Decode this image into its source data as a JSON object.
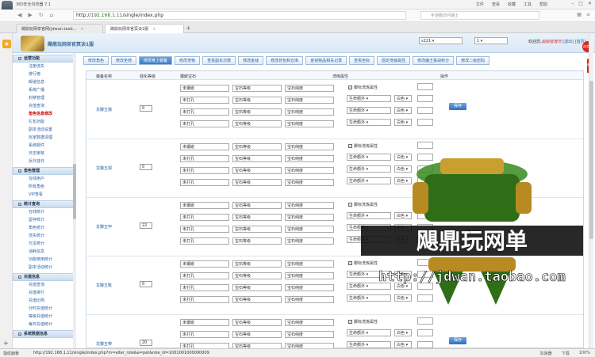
{
  "browser": {
    "title": "360安全浏览器 7.1",
    "menu": [
      "文件",
      "查看",
      "收藏",
      "工具",
      "帮助"
    ],
    "url_prefix": "http://",
    "url_host": "192.168.1.11",
    "url_path": "/single/index.php",
    "search_placeholder": "手游圈访问瑞士",
    "tabs": [
      {
        "label": "飓鼎玩网单官网(jdwan.taob...",
        "active": false
      },
      {
        "label": "飓鼎玩网单官冥诀1服",
        "active": true
      }
    ]
  },
  "header": {
    "site_name": "飓鼎玩网单官冥诀1服",
    "server_select": "s221",
    "server_num": "1",
    "welcome_prefix": "欢迎您,",
    "user": "超级管理员",
    "links": "[退出] [首页]"
  },
  "side_badge": {
    "top": "选定新游",
    "bottom": "PK"
  },
  "sidebar": {
    "sections": [
      {
        "title": "运营功能",
        "items": [
          {
            "label": "注册流失"
          },
          {
            "label": "排行榜"
          },
          {
            "label": "邮递信息"
          },
          {
            "label": "系统广播"
          },
          {
            "label": "封禁管理"
          },
          {
            "label": "充值查询"
          },
          {
            "label": "角色信息修改",
            "active": true
          },
          {
            "label": "礼包功能"
          },
          {
            "label": "副本活动设置"
          },
          {
            "label": "玩家数据清理"
          },
          {
            "label": "系统邮件"
          },
          {
            "label": "日志审核"
          },
          {
            "label": "反外挂日"
          }
        ]
      },
      {
        "title": "角色管理",
        "items": [
          {
            "label": "在线用户"
          },
          {
            "label": "所有角色"
          },
          {
            "label": "VIP查看"
          }
        ]
      },
      {
        "title": "统计查询",
        "items": [
          {
            "label": "在线统计"
          },
          {
            "label": "留存统计"
          },
          {
            "label": "角色统计"
          },
          {
            "label": "流失统计"
          },
          {
            "label": "元宝统计"
          },
          {
            "label": "消耗信息"
          },
          {
            "label": "功能使用统计"
          },
          {
            "label": "副本活动统计"
          }
        ]
      },
      {
        "title": "充值信息",
        "items": [
          {
            "label": "充值查询"
          },
          {
            "label": "充值排行"
          },
          {
            "label": "充值比例"
          },
          {
            "label": "分时充值统计"
          },
          {
            "label": "等级充值统计"
          },
          {
            "label": "每日充值统计"
          }
        ]
      },
      {
        "title": "系统数据信息",
        "items": []
      }
    ]
  },
  "subtabs": [
    {
      "label": "修改角色",
      "active": false
    },
    {
      "label": "修改坐骑",
      "active": false
    },
    {
      "label": "修改身上装备",
      "active": true
    },
    {
      "label": "修改宠物",
      "active": false
    },
    {
      "label": "查看副本次数",
      "active": false
    },
    {
      "label": "修改金钱",
      "active": false
    },
    {
      "label": "修改背包和仓库",
      "active": false
    },
    {
      "label": "金钱物品相关记录",
      "active": false
    },
    {
      "label": "查看坐标",
      "active": false
    },
    {
      "label": "固定宠装属性",
      "active": false
    },
    {
      "label": "修改魔王挑战积分",
      "active": false
    },
    {
      "label": "修改二级密码",
      "active": false
    }
  ],
  "table": {
    "headers": {
      "name": "装备名称",
      "level": "强化等级",
      "gems": "镶嵌宝石",
      "wash": "洗练属性",
      "op": "操作"
    },
    "wash_checkbox_label": "脚标洗炼属性",
    "attr_label": "生命额外",
    "color_label": "白色",
    "save_label": "保存",
    "gems": [
      [
        "未镶嵌",
        "宝石等级",
        "宝石纯度"
      ],
      [
        "未打孔",
        "宝石等级",
        "宝石纯度"
      ],
      [
        "未打孔",
        "宝石等级",
        "宝石纯度"
      ],
      [
        "未打孔",
        "宝石等级",
        "宝石纯度"
      ]
    ],
    "rows": [
      {
        "name": "龙滕五蕴",
        "level": "0"
      },
      {
        "name": "龙滕五铜",
        "level": "0"
      },
      {
        "name": "龙滕五甲",
        "level": "22"
      },
      {
        "name": "龙滕五靴",
        "level": "0"
      },
      {
        "name": "龙滕五带",
        "level": "20"
      }
    ]
  },
  "watermark": {
    "brand": "飓鼎玩网单",
    "url": "http://jdwan.taobao.com"
  },
  "status": {
    "left": "指纹面板",
    "url": "http://192.168.1.11/single/index.php?m=alter_role&a=pet&role_id=1001001000000009",
    "right": [
      "加速器",
      "下载",
      "100%"
    ]
  }
}
